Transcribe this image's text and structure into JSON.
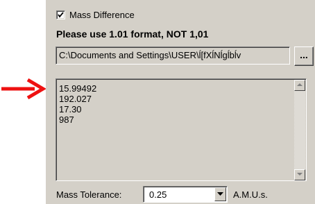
{
  "checkbox": {
    "label": "Mass Difference",
    "checked": true
  },
  "notice": "Please use 1.01 format, NOT 1,01",
  "path_field": {
    "value": "C:\\Documents and Settings\\USER\\ĺ[fXĺNĺgĺbĺv"
  },
  "browse_button": {
    "label": "..."
  },
  "mass_list": {
    "items": [
      "15.99492",
      "192.027",
      "17.30",
      "987"
    ]
  },
  "tolerance": {
    "label": "Mass Tolerance:",
    "value": "0.25",
    "units": "A.M.U.s."
  },
  "annotation": {
    "arrow_color": "#ee1111"
  }
}
